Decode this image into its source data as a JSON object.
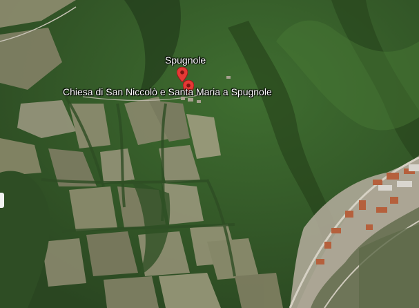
{
  "map": {
    "view": "satellite",
    "places": [
      {
        "name": "Spugnole",
        "icon": "map-pin-icon",
        "color": "#e53935"
      },
      {
        "name": "Chiesa di San Niccolò e Santa Maria a Spugnole",
        "icon": "map-pin-icon",
        "color": "#e53935"
      }
    ]
  },
  "colors": {
    "forest_dark": "#2b4a22",
    "forest_mid": "#3d6a2e",
    "field_light": "#9a9a78",
    "field_dark": "#6f6f55",
    "urban": "#b9b2a6",
    "road": "#d8d4c8",
    "roof": "#b5603c"
  }
}
